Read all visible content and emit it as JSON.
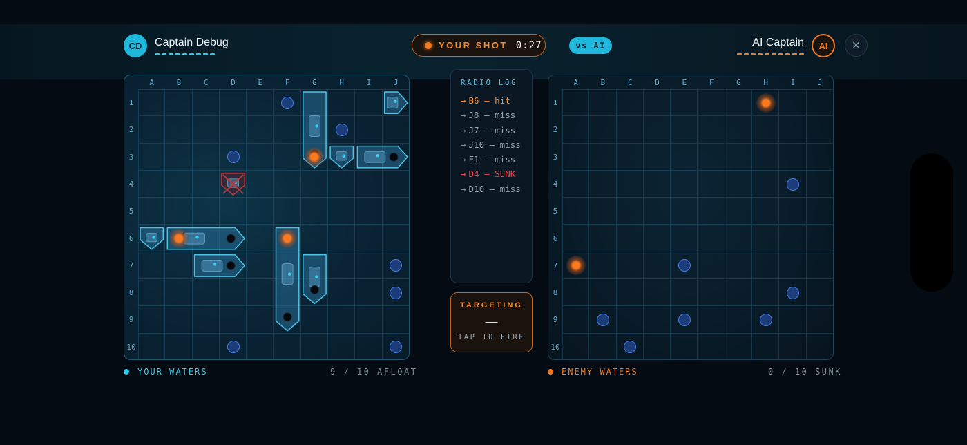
{
  "player": {
    "initials": "CD",
    "name": "Captain Debug",
    "ships_remaining": 9
  },
  "opponent": {
    "initials": "AI",
    "name": "AI Captain",
    "ships_remaining": 10
  },
  "turn": {
    "label": "YOUR SHOT",
    "timer": "0:27"
  },
  "mode_badge": "vs AI",
  "close_icon": "close-icon",
  "columns": [
    "A",
    "B",
    "C",
    "D",
    "E",
    "F",
    "G",
    "H",
    "I",
    "J"
  ],
  "rows": [
    "1",
    "2",
    "3",
    "4",
    "5",
    "6",
    "7",
    "8",
    "9",
    "10"
  ],
  "your_board": {
    "footer_label": "YOUR WATERS",
    "footer_count": "9 / 10 AFLOAT",
    "ships": [
      {
        "cells": [
          "J1"
        ],
        "orientation": "horizontal",
        "sunk": false
      },
      {
        "cells": [
          "G1",
          "G2",
          "G3"
        ],
        "orientation": "vertical",
        "sunk": false
      },
      {
        "cells": [
          "H3"
        ],
        "orientation": "vertical",
        "sunk": false
      },
      {
        "cells": [
          "I3",
          "J3"
        ],
        "orientation": "horizontal",
        "sunk": false
      },
      {
        "cells": [
          "D4"
        ],
        "orientation": "vertical",
        "sunk": true
      },
      {
        "cells": [
          "A6"
        ],
        "orientation": "vertical",
        "sunk": false
      },
      {
        "cells": [
          "B6",
          "C6",
          "D6"
        ],
        "orientation": "horizontal",
        "sunk": false
      },
      {
        "cells": [
          "C7",
          "D7"
        ],
        "orientation": "horizontal",
        "sunk": false
      },
      {
        "cells": [
          "F6",
          "F7",
          "F8",
          "F9"
        ],
        "orientation": "vertical",
        "sunk": false
      },
      {
        "cells": [
          "G7",
          "G8"
        ],
        "orientation": "vertical",
        "sunk": false
      }
    ],
    "misses": [
      "F1",
      "H2",
      "D3",
      "J7",
      "J8",
      "D10",
      "J10"
    ],
    "hits": [
      "G3",
      "B6",
      "F6"
    ]
  },
  "enemy_board": {
    "footer_label": "ENEMY WATERS",
    "footer_count": "0 / 10 SUNK",
    "misses": [
      "I4",
      "E7",
      "I8",
      "B9",
      "E9",
      "H9",
      "C10"
    ],
    "hits": [
      "H1",
      "A7"
    ]
  },
  "radio_log": {
    "title": "RADIO LOG",
    "entries": [
      {
        "text": "B6 — hit",
        "type": "hit"
      },
      {
        "text": "J8 — miss",
        "type": "miss"
      },
      {
        "text": "J7 — miss",
        "type": "miss"
      },
      {
        "text": "J10 — miss",
        "type": "miss"
      },
      {
        "text": "F1 — miss",
        "type": "miss"
      },
      {
        "text": "D4 — SUNK",
        "type": "sunk"
      },
      {
        "text": "D10 — miss",
        "type": "miss"
      }
    ]
  },
  "targeting": {
    "title": "TARGETING",
    "value": "—",
    "subtitle": "TAP TO FIRE"
  },
  "colors": {
    "player_accent": "#1fb8dc",
    "enemy_accent": "#f07a24",
    "miss": "#3f7ee0",
    "hit": "#ff7a1e",
    "sunk": "#e8484a"
  }
}
